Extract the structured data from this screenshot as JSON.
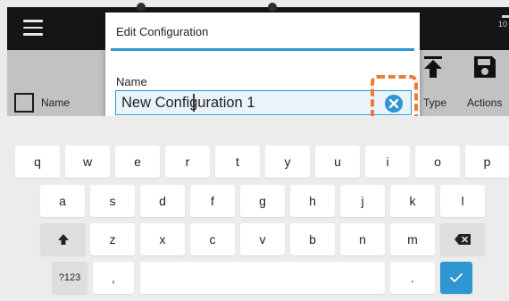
{
  "app": {
    "menu_icon": "hamburger-icon",
    "header_fragment": "10",
    "columns": {
      "name": "Name",
      "type": "Type",
      "actions": "Actions"
    },
    "upload_icon": "upload-icon",
    "save_icon": "floppy-disk-icon"
  },
  "dialog": {
    "title": "Edit Configuration",
    "field_label": "Name",
    "field_value": "New Configuration 1",
    "clear_icon": "clear-x-icon",
    "highlight_color": "#ee7a33",
    "accent_color": "#2e96d3"
  },
  "keyboard": {
    "row1": [
      "q",
      "w",
      "e",
      "r",
      "t",
      "y",
      "u",
      "i",
      "o",
      "p"
    ],
    "row2": [
      "a",
      "s",
      "d",
      "f",
      "g",
      "h",
      "j",
      "k",
      "l"
    ],
    "row3": [
      "z",
      "x",
      "c",
      "v",
      "b",
      "n",
      "m"
    ],
    "shift_icon": "shift-arrow-icon",
    "backspace_icon": "backspace-icon",
    "symbols_label": "?123",
    "comma": ",",
    "period": ".",
    "enter_icon": "checkmark-icon"
  }
}
